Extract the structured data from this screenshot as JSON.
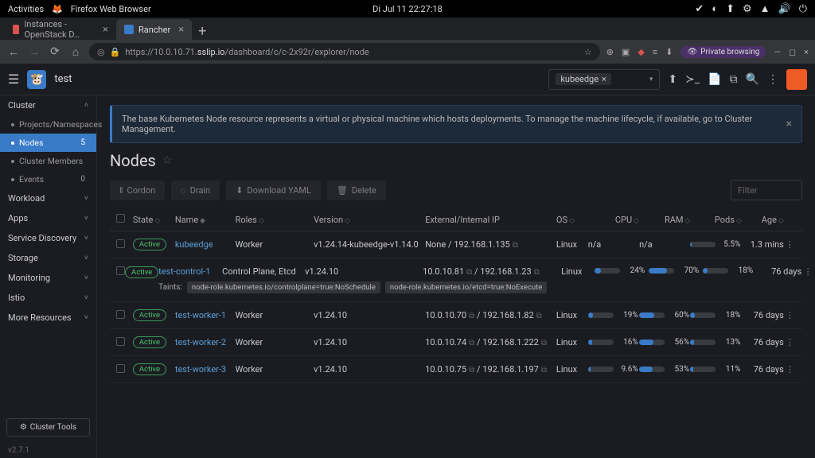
{
  "os": {
    "activities": "Activities",
    "app": "Firefox Web Browser",
    "clock": "Di Jul 11  22:27:18"
  },
  "browser": {
    "tabs": [
      {
        "label": "Instances - OpenStack D…",
        "active": false,
        "fav": "red"
      },
      {
        "label": "Rancher",
        "active": true,
        "fav": "blue"
      }
    ],
    "url_prefix": "https://10.0.10.71.",
    "url_domain": "sslip.io",
    "url_path": "/dashboard/c/c-2x92r/explorer/node",
    "private": "Private browsing"
  },
  "header": {
    "breadcrumb": "test",
    "combo_chip": "kubeedge"
  },
  "sidebar": {
    "sec_cluster": "Cluster",
    "items": [
      {
        "label": "Projects/Namespaces"
      },
      {
        "label": "Nodes",
        "badge": "5",
        "active": true
      },
      {
        "label": "Cluster Members"
      },
      {
        "label": "Events",
        "badge": "0"
      }
    ],
    "secs": [
      "Workload",
      "Apps",
      "Service Discovery",
      "Storage",
      "Monitoring",
      "Istio",
      "More Resources"
    ],
    "tools": "Cluster Tools",
    "version": "v2.7.1"
  },
  "banner": {
    "text": "The base Kubernetes Node resource represents a virtual or physical machine which hosts deployments. To manage the machine lifecycle, if available, go to Cluster Management."
  },
  "page": {
    "title": "Nodes",
    "btn_cordon": "Cordon",
    "btn_drain": "Drain",
    "btn_yaml": "Download YAML",
    "btn_delete": "Delete",
    "filter_ph": "Filter",
    "cols": {
      "state": "State",
      "name": "Name",
      "roles": "Roles",
      "version": "Version",
      "ip": "External/Internal IP",
      "os": "OS",
      "cpu": "CPU",
      "ram": "RAM",
      "pods": "Pods",
      "age": "Age"
    }
  },
  "rows": [
    {
      "state": "Active",
      "name": "kubeedge",
      "roles": "Worker",
      "version": "v1.24.14-kubeedge-v1.14.0",
      "ip": "None / 192.168.1.135",
      "os": "Linux",
      "cpu": "n/a",
      "cpuv": null,
      "ram": "n/a",
      "ramv": null,
      "pods": "5.5%",
      "podsv": 5.5,
      "age": "1.3 mins",
      "taints": null
    },
    {
      "state": "Active",
      "name": "test-control-1",
      "roles": "Control Plane, Etcd",
      "version": "v1.24.10",
      "ip": "10.0.10.81",
      "ip2": " / 192.168.1.23",
      "os": "Linux",
      "cpu": "24%",
      "cpuv": 24,
      "ram": "70%",
      "ramv": 70,
      "pods": "18%",
      "podsv": 18,
      "age": "76 days",
      "taints": [
        "node-role.kubernetes.io/controlplane=true:NoSchedule",
        "node-role.kubernetes.io/etcd=true:NoExecute"
      ]
    },
    {
      "state": "Active",
      "name": "test-worker-1",
      "roles": "Worker",
      "version": "v1.24.10",
      "ip": "10.0.10.70",
      "ip2": " / 192.168.1.82",
      "os": "Linux",
      "cpu": "19%",
      "cpuv": 19,
      "ram": "60%",
      "ramv": 60,
      "pods": "18%",
      "podsv": 18,
      "age": "76 days",
      "taints": null
    },
    {
      "state": "Active",
      "name": "test-worker-2",
      "roles": "Worker",
      "version": "v1.24.10",
      "ip": "10.0.10.74",
      "ip2": " / 192.168.1.222",
      "os": "Linux",
      "cpu": "16%",
      "cpuv": 16,
      "ram": "56%",
      "ramv": 56,
      "pods": "13%",
      "podsv": 13,
      "age": "76 days",
      "taints": null
    },
    {
      "state": "Active",
      "name": "test-worker-3",
      "roles": "Worker",
      "version": "v1.24.10",
      "ip": "10.0.10.75",
      "ip2": " / 192.168.1.197",
      "os": "Linux",
      "cpu": "9.6%",
      "cpuv": 9.6,
      "ram": "53%",
      "ramv": 53,
      "pods": "11%",
      "podsv": 11,
      "age": "76 days",
      "taints": null
    }
  ]
}
